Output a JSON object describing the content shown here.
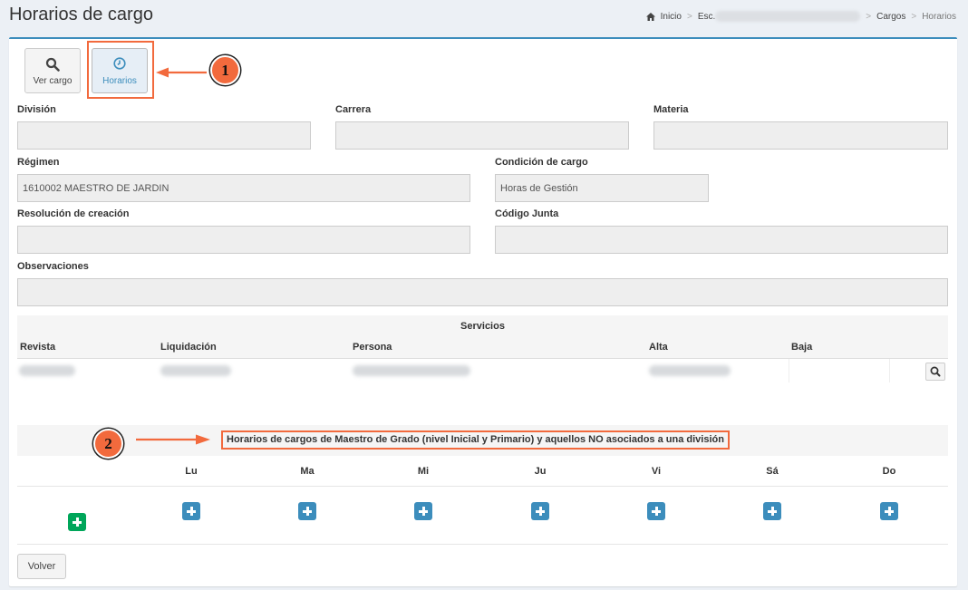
{
  "page": {
    "title": "Horarios de cargo"
  },
  "breadcrumb": {
    "home": "Inicio",
    "school_prefix": "Esc.",
    "cargos": "Cargos",
    "current": "Horarios"
  },
  "tabs": {
    "ver_cargo": "Ver cargo",
    "horarios": "Horarios"
  },
  "annotations": {
    "badge1": "1",
    "badge2": "2",
    "accent_color": "#f26a3d"
  },
  "form": {
    "division_label": "División",
    "carrera_label": "Carrera",
    "materia_label": "Materia",
    "regimen_label": "Régimen",
    "regimen_value": "1610002 MAESTRO DE JARDIN",
    "condicion_label": "Condición de cargo",
    "condicion_value": "Horas de Gestión",
    "resolucion_label": "Resolución de creación",
    "codigo_label": "Código Junta",
    "observaciones_label": "Observaciones"
  },
  "servicios": {
    "title": "Servicios",
    "columns": [
      "Revista",
      "Liquidación",
      "Persona",
      "Alta",
      "Baja"
    ]
  },
  "horarios": {
    "title": "Horarios de cargos de Maestro de Grado (nivel Inicial y Primario) y aquellos NO asociados a una división",
    "days": [
      "Lu",
      "Ma",
      "Mi",
      "Ju",
      "Vi",
      "Sá",
      "Do"
    ]
  },
  "footer": {
    "volver": "Volver"
  },
  "colors": {
    "primary": "#3c8dbc",
    "success": "#00a65a"
  }
}
